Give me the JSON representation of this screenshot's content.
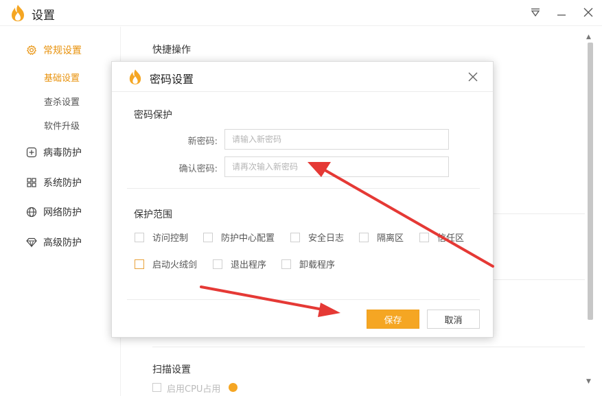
{
  "window": {
    "title": "设置",
    "controls": [
      {
        "name": "menu-icon",
        "glyph": "▽"
      },
      {
        "name": "minimize-icon",
        "glyph": "—"
      },
      {
        "name": "close-icon",
        "glyph": "✕"
      }
    ]
  },
  "sidebar": {
    "groups": [
      {
        "label": "常规设置",
        "icon": "gear-icon",
        "active": true,
        "subitems": [
          {
            "label": "基础设置",
            "active": true
          },
          {
            "label": "查杀设置",
            "active": false
          },
          {
            "label": "软件升级",
            "active": false
          }
        ]
      },
      {
        "label": "病毒防护",
        "icon": "plus-square-icon",
        "active": false
      },
      {
        "label": "系统防护",
        "icon": "windows-icon",
        "active": false
      },
      {
        "label": "网络防护",
        "icon": "globe-icon",
        "active": false
      },
      {
        "label": "高级防护",
        "icon": "diamond-icon",
        "active": false
      }
    ]
  },
  "content": {
    "section_quick_ops": "快捷操作",
    "section_scan": "扫描设置",
    "scan_option_label": "启用CPU占用"
  },
  "dialog": {
    "title": "密码设置",
    "password_section": "密码保护",
    "new_password": {
      "label": "新密码:",
      "value": "",
      "placeholder": "请输入新密码"
    },
    "confirm_password": {
      "label": "确认密码:",
      "value": "",
      "placeholder": "请再次输入新密码"
    },
    "scope_section": "保护范围",
    "scope_row1": [
      {
        "label": "访问控制",
        "checked": false
      },
      {
        "label": "防护中心配置",
        "checked": false
      },
      {
        "label": "安全日志",
        "checked": false
      },
      {
        "label": "隔离区",
        "checked": false
      },
      {
        "label": "信任区",
        "checked": false
      }
    ],
    "scope_row2": [
      {
        "label": "启动火绒剑",
        "checked": false,
        "highlighted": true
      },
      {
        "label": "退出程序",
        "checked": false
      },
      {
        "label": "卸载程序",
        "checked": false
      }
    ],
    "save_label": "保存",
    "cancel_label": "取消"
  },
  "colors": {
    "accent": "#f5a623",
    "active_text": "#e8920c",
    "annotation_arrow": "#e53935"
  }
}
